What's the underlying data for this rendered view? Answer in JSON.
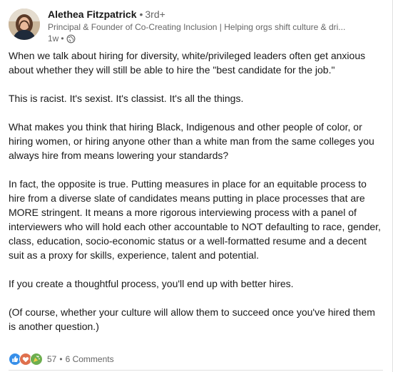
{
  "author": {
    "name": "Alethea Fitzpatrick",
    "degree": "3rd+",
    "headline": "Principal & Founder of Co-Creating Inclusion | Helping orgs shift culture & dri...",
    "time": "1w"
  },
  "post": {
    "paragraphs": [
      "When we talk about hiring for diversity, white/privileged leaders often get anxious about whether they will still be able to hire the \"best candidate for the job.\"",
      "This is racist. It's sexist. It's classist. It's all the things.",
      "What makes you think that hiring Black, Indigenous and other people of color, or hiring women, or hiring anyone other than a white man from the same colleges you always hire from means lowering your standards?",
      "In fact, the opposite is true. Putting measures in place for an equitable process to hire from a diverse slate of candidates means putting in place processes that are MORE stringent. It means a more rigorous interviewing process with a panel of interviewers who will hold each other accountable to NOT defaulting to race, gender, class, education, socio-economic status or a well-formatted resume and a decent suit as a proxy for skills, experience, talent and potential.",
      "If you create a thoughtful process, you'll end up with better hires.",
      "(Of course, whether your culture will allow them to succeed once you've hired them is another question.)"
    ]
  },
  "social": {
    "reaction_count": "57",
    "comments": "6 Comments",
    "reaction_icons": [
      "like-icon",
      "love-icon",
      "celebrate-icon"
    ]
  },
  "colors": {
    "text": "#191919",
    "muted": "#666666",
    "like": "#378fe9",
    "love": "#df704d",
    "celebrate": "#44712e"
  }
}
